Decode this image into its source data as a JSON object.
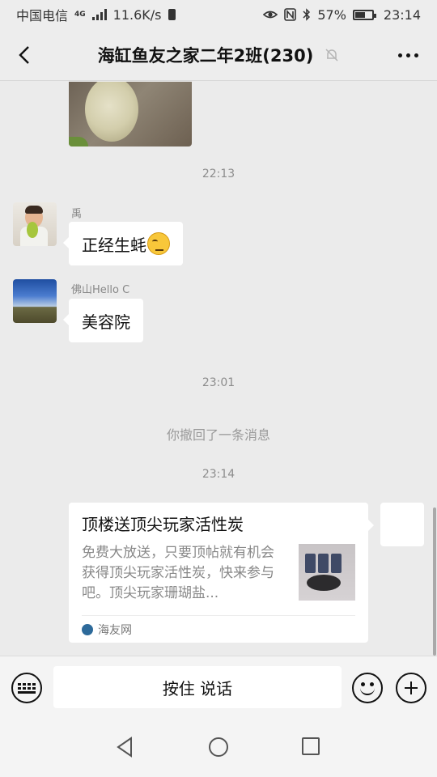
{
  "status_bar": {
    "carrier": "中国电信",
    "network": "4G",
    "speed": "11.6K/s",
    "battery": "57%",
    "battery_level": 0.57,
    "time": "23:14"
  },
  "nav": {
    "title": "海缸鱼友之家二年2班(230)",
    "icons": [
      "back-arrow-icon",
      "mute-bell-icon",
      "more-dots-icon"
    ]
  },
  "chat": {
    "time_1": "22:13",
    "messages": [
      {
        "sender": "禹",
        "text": "正经生蚝",
        "emoji": "thinking-face-emoji"
      },
      {
        "sender": "佛山Hello C",
        "text": "美容院"
      }
    ],
    "time_2": "23:01",
    "recall_notice": "你撤回了一条消息",
    "time_3": "23:14",
    "link_card": {
      "title": "顶楼送顶尖玩家活性炭",
      "description": "免费大放送，只要顶帖就有机会获得顶尖玩家活性炭，快来参与吧。顶尖玩家珊瑚盐...",
      "source": "海友网"
    }
  },
  "input_bar": {
    "talk_label": "按住 说话"
  },
  "colors": {
    "chat_background": "#ebebeb",
    "bubble": "#ffffff",
    "timestamp": "#8c8c8c"
  }
}
